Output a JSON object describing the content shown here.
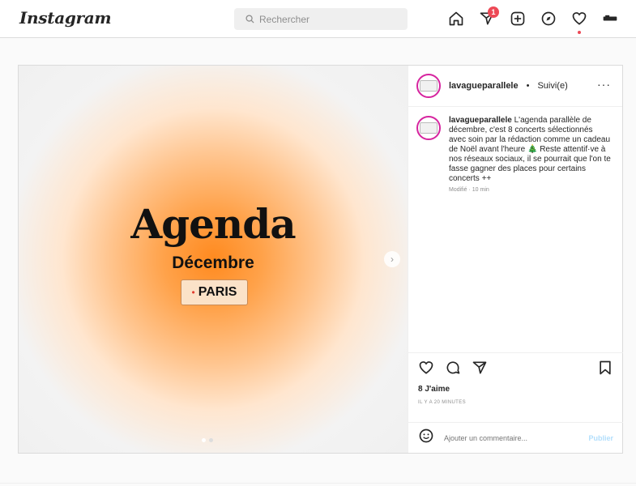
{
  "nav": {
    "logo": "Instagram",
    "search_placeholder": "Rechercher",
    "notification_count": "1",
    "icons": [
      "home-icon",
      "direct-message-icon",
      "new-post-icon",
      "explore-icon",
      "activity-heart-icon",
      "profile-icon"
    ]
  },
  "post": {
    "image": {
      "title": "Agenda",
      "subtitle": "Décembre",
      "location_tag": "PARIS",
      "slide_count": 2,
      "active_slide": 1
    },
    "header": {
      "username": "lavagueparallele",
      "separator": "•",
      "follow_status": "Suivi(e)"
    },
    "caption": {
      "username": "lavagueparallele",
      "text": "L'agenda parallèle de décembre, c'est 8 concerts sélectionnés avec soin par la rédaction comme un cadeau de Noël avant l'heure 🎄 Reste attentif·ve à nos réseaux sociaux, il se pourrait que l'on te fasse gagner des places pour certains concerts ++",
      "time": "Modifié · 10 min"
    },
    "likes": "8 J'aime",
    "time_ago": "IL Y A 20 MINUTES",
    "comment_placeholder": "Ajouter un commentaire...",
    "publish_label": "Publier"
  },
  "colors": {
    "accent_orange": "#ff8a1f",
    "badge_red": "#ed4956",
    "publish_blue": "#b2dffc",
    "avatar_ring": "#d6249f"
  }
}
